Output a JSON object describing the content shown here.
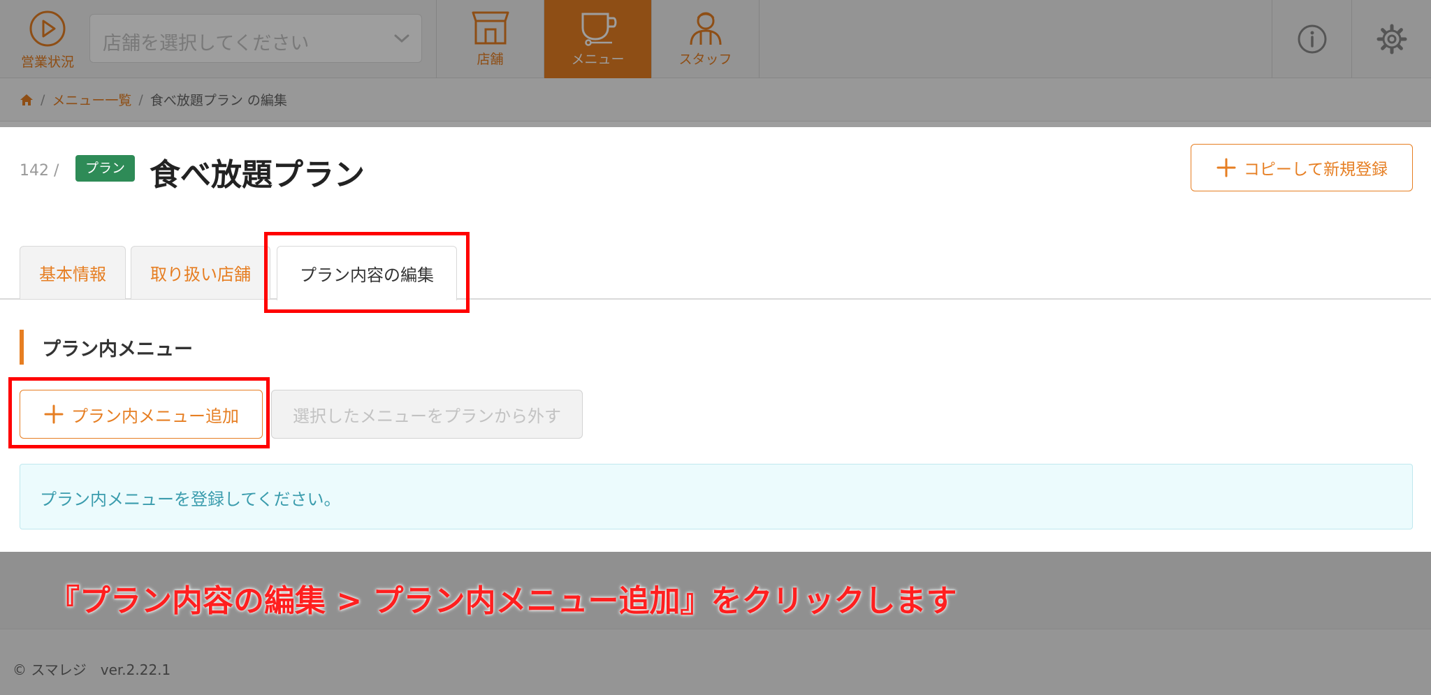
{
  "header": {
    "status_label": "営業状況",
    "store_placeholder": "店舗を選択してください",
    "nav": [
      {
        "label": "店舗",
        "icon": "store-icon",
        "active": false
      },
      {
        "label": "メニュー",
        "icon": "cup-icon",
        "active": true
      },
      {
        "label": "スタッフ",
        "icon": "staff-icon",
        "active": false
      }
    ],
    "accent": "#e67e22"
  },
  "breadcrumb": {
    "items": [
      "メニュー一覧",
      "食べ放題プラン の編集"
    ]
  },
  "page": {
    "id": "142 /",
    "badge": "プラン",
    "title": "食べ放題プラン",
    "copy_label": "コピーして新規登録"
  },
  "tabs": [
    {
      "label": "基本情報",
      "active": false
    },
    {
      "label": "取り扱い店舗",
      "active": false
    },
    {
      "label": "プラン内容の編集",
      "active": true
    }
  ],
  "section": {
    "title": "プラン内メニュー",
    "add_label": "プラン内メニュー追加",
    "remove_label": "選択したメニューをプランから外す",
    "empty_message": "プラン内メニューを登録してください。"
  },
  "instruction": "『プラン内容の編集 > プラン内メニュー追加』をクリックします",
  "footer": {
    "copyright": "© スマレジ　ver.2.22.1"
  }
}
